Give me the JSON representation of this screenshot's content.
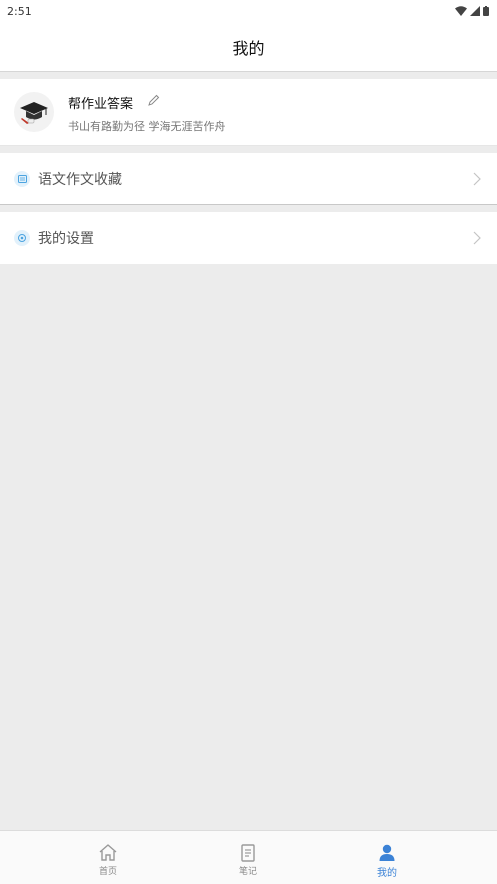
{
  "status_bar": {
    "time": "2:51"
  },
  "header": {
    "title": "我的"
  },
  "profile": {
    "name": "帮作业答案",
    "motto": "书山有路勤为径 学海无涯苦作舟"
  },
  "menu": {
    "items": [
      {
        "label": "语文作文收藏",
        "icon": "book-icon"
      },
      {
        "label": "我的设置",
        "icon": "settings-icon"
      }
    ]
  },
  "tabs": [
    {
      "label": "首页",
      "icon": "home-icon",
      "active": false
    },
    {
      "label": "笔记",
      "icon": "note-icon",
      "active": false
    },
    {
      "label": "我的",
      "icon": "user-icon",
      "active": true
    }
  ],
  "colors": {
    "accent": "#3b82d6",
    "background": "#ececec"
  }
}
